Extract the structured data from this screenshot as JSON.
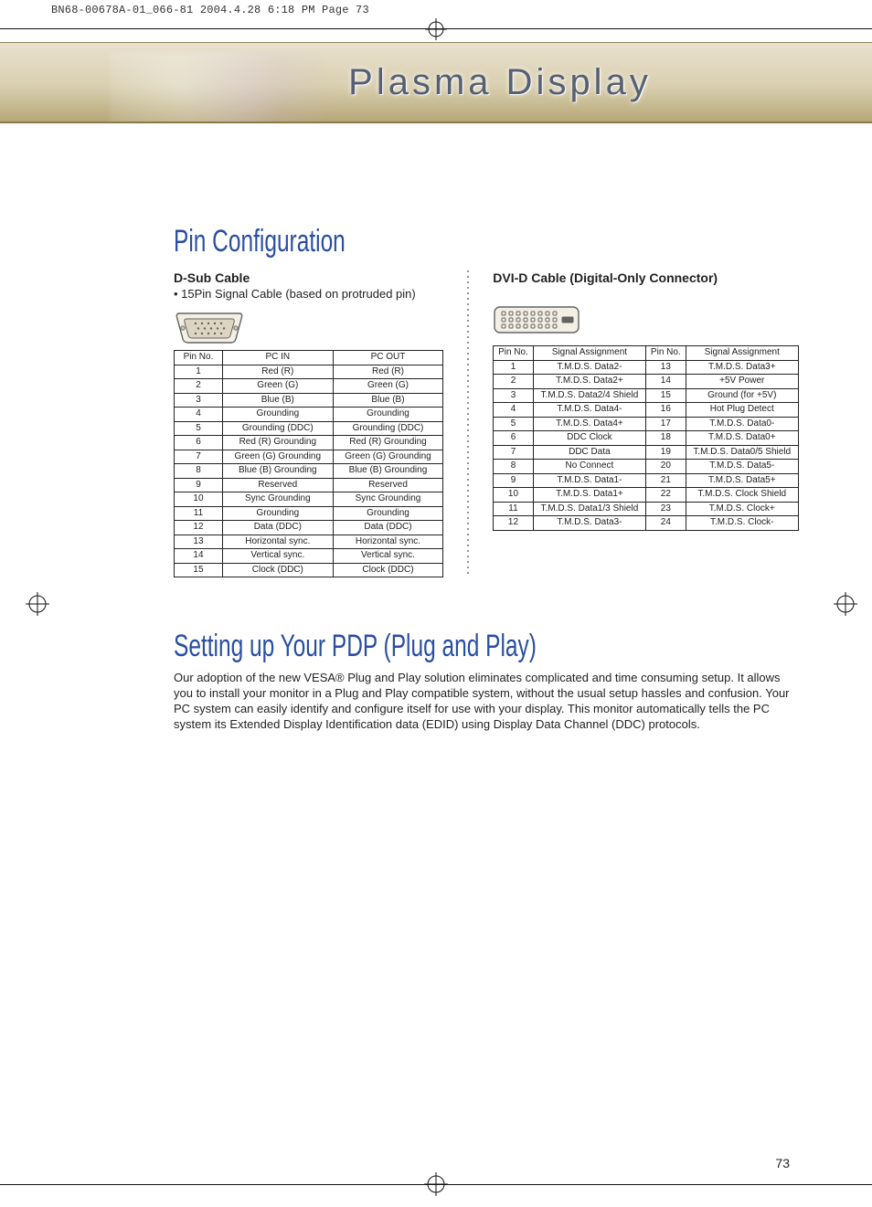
{
  "header_meta": "BN68-00678A-01_066-81  2004.4.28  6:18 PM  Page 73",
  "banner_title": "Plasma Display",
  "section1": {
    "title": "Pin Configuration",
    "left": {
      "heading": "D-Sub Cable",
      "note": "• 15Pin Signal Cable (based on protruded pin)",
      "table_headers": [
        "Pin No.",
        "PC IN",
        "PC OUT"
      ],
      "rows": [
        [
          "1",
          "Red (R)",
          "Red (R)"
        ],
        [
          "2",
          "Green (G)",
          "Green (G)"
        ],
        [
          "3",
          "Blue (B)",
          "Blue (B)"
        ],
        [
          "4",
          "Grounding",
          "Grounding"
        ],
        [
          "5",
          "Grounding (DDC)",
          "Grounding (DDC)"
        ],
        [
          "6",
          "Red (R) Grounding",
          "Red (R) Grounding"
        ],
        [
          "7",
          "Green (G) Grounding",
          "Green (G) Grounding"
        ],
        [
          "8",
          "Blue (B) Grounding",
          "Blue (B) Grounding"
        ],
        [
          "9",
          "Reserved",
          "Reserved"
        ],
        [
          "10",
          "Sync Grounding",
          "Sync Grounding"
        ],
        [
          "11",
          "Grounding",
          "Grounding"
        ],
        [
          "12",
          "Data (DDC)",
          "Data (DDC)"
        ],
        [
          "13",
          "Horizontal sync.",
          "Horizontal sync."
        ],
        [
          "14",
          "Vertical sync.",
          "Vertical sync."
        ],
        [
          "15",
          "Clock (DDC)",
          "Clock (DDC)"
        ]
      ]
    },
    "right": {
      "heading": "DVI-D Cable (Digital-Only Connector)",
      "table_headers": [
        "Pin No.",
        "Signal Assignment",
        "Pin No.",
        "Signal Assignment"
      ],
      "rows": [
        [
          "1",
          "T.M.D.S. Data2-",
          "13",
          "T.M.D.S. Data3+"
        ],
        [
          "2",
          "T.M.D.S. Data2+",
          "14",
          "+5V Power"
        ],
        [
          "3",
          "T.M.D.S. Data2/4 Shield",
          "15",
          "Ground (for +5V)"
        ],
        [
          "4",
          "T.M.D.S. Data4-",
          "16",
          "Hot Plug Detect"
        ],
        [
          "5",
          "T.M.D.S. Data4+",
          "17",
          "T.M.D.S. Data0-"
        ],
        [
          "6",
          "DDC  Clock",
          "18",
          "T.M.D.S. Data0+"
        ],
        [
          "7",
          "DDC Data",
          "19",
          "T.M.D.S. Data0/5 Shield"
        ],
        [
          "8",
          "No Connect",
          "20",
          "T.M.D.S. Data5-"
        ],
        [
          "9",
          "T.M.D.S. Data1-",
          "21",
          "T.M.D.S. Data5+"
        ],
        [
          "10",
          "T.M.D.S. Data1+",
          "22",
          "T.M.D.S. Clock Shield"
        ],
        [
          "11",
          "T.M.D.S. Data1/3 Shield",
          "23",
          "T.M.D.S. Clock+"
        ],
        [
          "12",
          "T.M.D.S. Data3-",
          "24",
          "T.M.D.S. Clock-"
        ]
      ]
    }
  },
  "section2": {
    "title": "Setting up Your PDP (Plug and Play)",
    "paragraph": "Our adoption of the new VESA® Plug and Play solution eliminates complicated and time consuming setup. It allows you to install your monitor in a Plug and Play compatible system, without the usual setup hassles and confusion. Your PC system can easily identify and configure itself for use with your display. This monitor automatically tells the PC system its Extended Display Identification data (EDID) using Display Data Channel (DDC) protocols."
  },
  "page_number": "73"
}
